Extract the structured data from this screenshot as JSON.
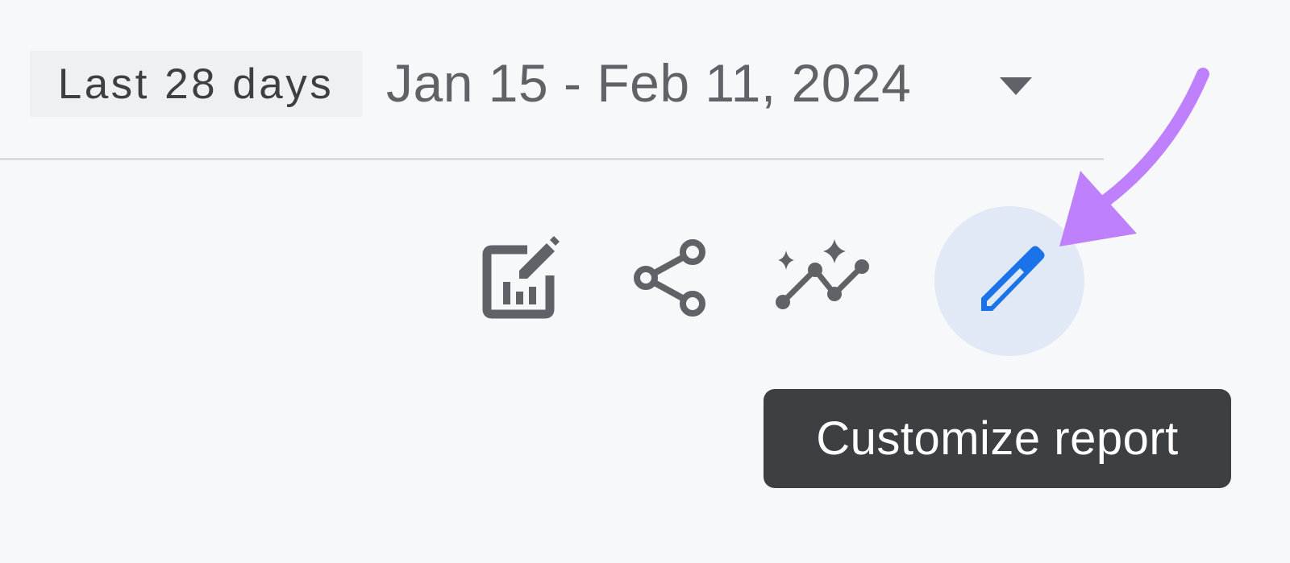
{
  "header": {
    "range_preset_label": "Last 28 days",
    "date_range_text": "Jan 15 - Feb 11, 2024"
  },
  "icons": {
    "dropdown": "arrow-drop-down-icon",
    "edit_report": "edit-report-chart-icon",
    "share": "share-icon",
    "insights": "insights-sparkle-icon",
    "customize": "pencil-icon"
  },
  "tooltip": {
    "text": "Customize report"
  },
  "colors": {
    "background": "#f7f8fa",
    "icon_gray": "#5f6368",
    "active_blue": "#1a73e8",
    "active_circle": "#e1e9f6",
    "tooltip_bg": "#3c4043",
    "annotation_purple": "#bf80fd"
  }
}
